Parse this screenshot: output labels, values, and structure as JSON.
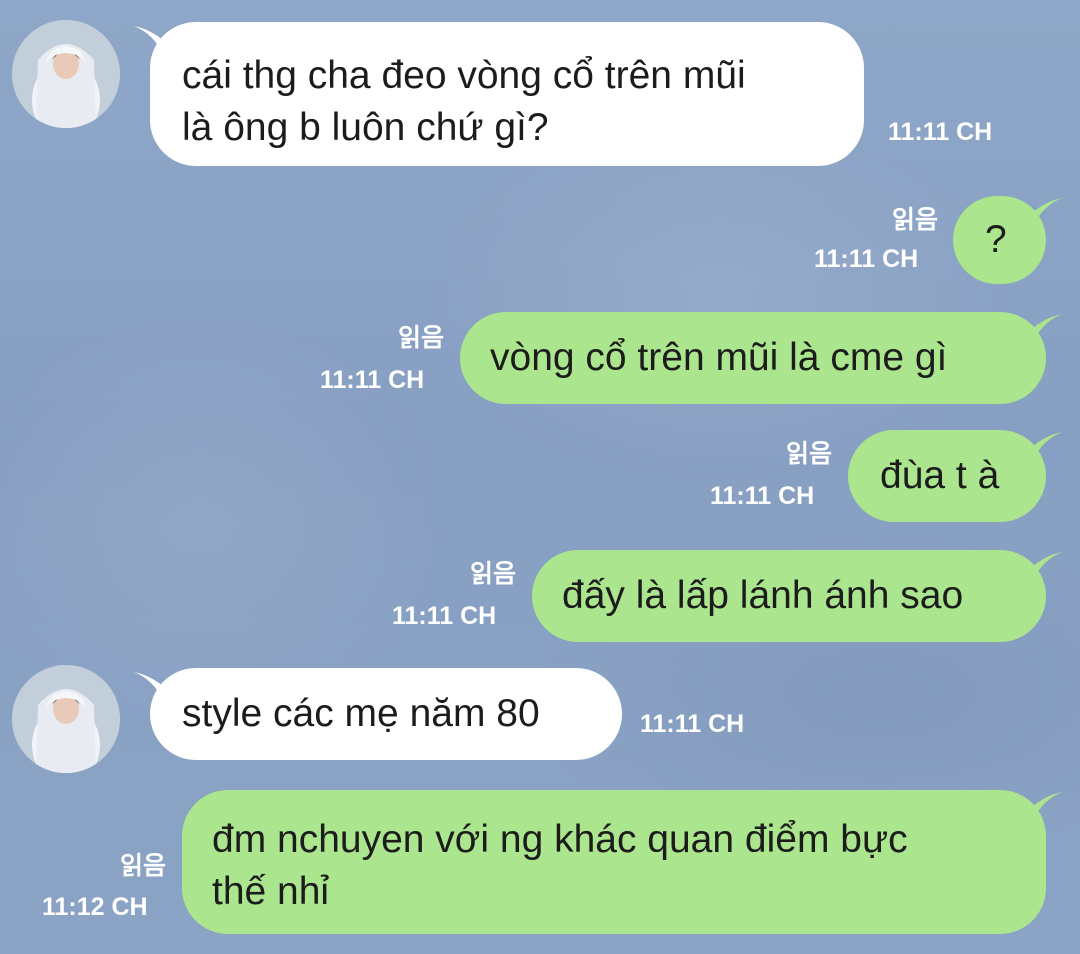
{
  "chat": {
    "read_label": "읽음",
    "messages": [
      {
        "from": "other",
        "lines": [
          "cái thg cha đeo vòng cổ trên mũi",
          "là ông b luôn chứ gì?"
        ],
        "time": "11:11 CH"
      },
      {
        "from": "me",
        "lines": [
          "?"
        ],
        "time": "11:11 CH",
        "read": "읽음"
      },
      {
        "from": "me",
        "lines": [
          "vòng cổ trên mũi là cme gì"
        ],
        "time": "11:11 CH",
        "read": "읽음"
      },
      {
        "from": "me",
        "lines": [
          "đùa t à"
        ],
        "time": "11:11 CH",
        "read": "읽음"
      },
      {
        "from": "me",
        "lines": [
          "đấy là lấp lánh ánh sao"
        ],
        "time": "11:11 CH",
        "read": "읽음"
      },
      {
        "from": "other",
        "lines": [
          "style các mẹ năm 80"
        ],
        "time": "11:11 CH"
      },
      {
        "from": "me",
        "lines": [
          "đm nchuyen với ng khác quan điểm bực",
          "thế nhỉ"
        ],
        "time": "11:12 CH",
        "read": "읽음"
      }
    ]
  },
  "colors": {
    "background": "#8ea5c6",
    "incoming_bubble": "#ffffff",
    "outgoing_bubble": "#abe68e",
    "meta_text": "#ffffff"
  },
  "icons": {
    "avatar": "avatar-girl-in-white-blanket"
  }
}
